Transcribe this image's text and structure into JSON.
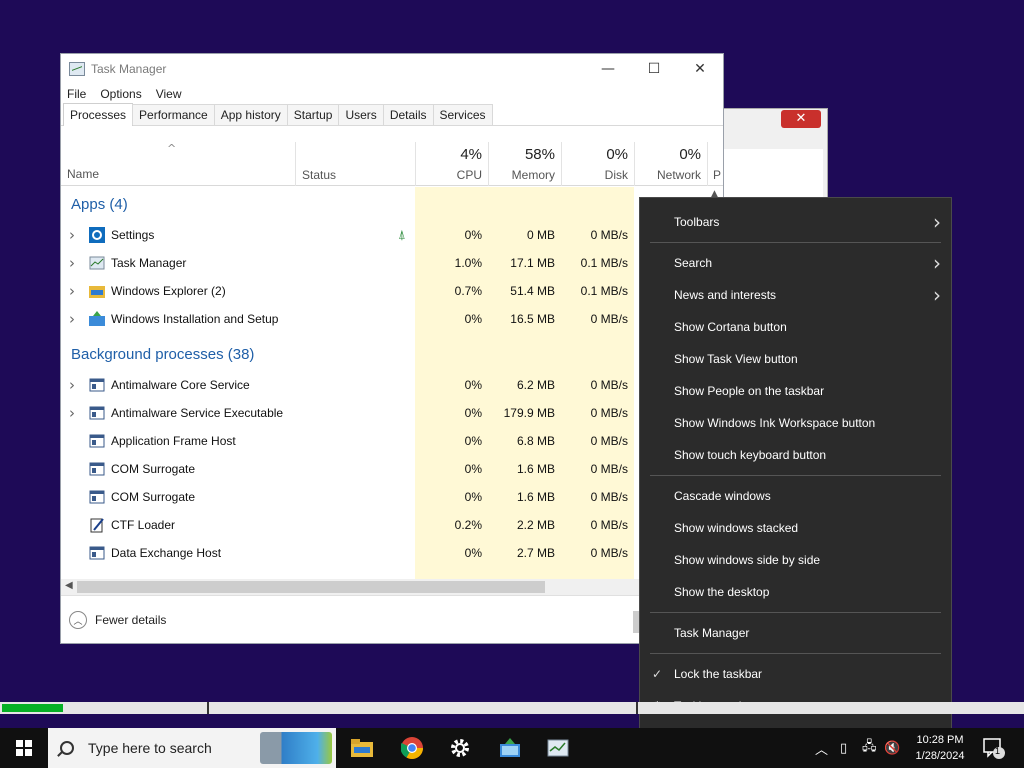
{
  "task_manager": {
    "title": "Task Manager",
    "menu": [
      "File",
      "Options",
      "View"
    ],
    "tabs": [
      "Processes",
      "Performance",
      "App history",
      "Startup",
      "Users",
      "Details",
      "Services"
    ],
    "active_tab": "Processes",
    "columns": {
      "name": "Name",
      "status": "Status",
      "cpu": {
        "pct": "4%",
        "label": "CPU"
      },
      "memory": {
        "pct": "58%",
        "label": "Memory"
      },
      "disk": {
        "pct": "0%",
        "label": "Disk"
      },
      "network": {
        "pct": "0%",
        "label": "Network"
      },
      "power": "P"
    },
    "groups": {
      "apps": "Apps (4)",
      "background": "Background processes (38)"
    },
    "apps": [
      {
        "name": "Settings",
        "cpu": "0%",
        "memory": "0 MB",
        "disk": "0 MB/s",
        "icon": "settings-gear-icon",
        "expandable": true,
        "suspended_leaf": true
      },
      {
        "name": "Task Manager",
        "cpu": "1.0%",
        "memory": "17.1 MB",
        "disk": "0.1 MB/s",
        "icon": "task-manager-icon",
        "expandable": true
      },
      {
        "name": "Windows Explorer (2)",
        "cpu": "0.7%",
        "memory": "51.4 MB",
        "disk": "0.1 MB/s",
        "icon": "folder-icon",
        "expandable": true
      },
      {
        "name": "Windows Installation and Setup",
        "cpu": "0%",
        "memory": "16.5 MB",
        "disk": "0 MB/s",
        "icon": "setup-icon",
        "expandable": true
      }
    ],
    "background": [
      {
        "name": "Antimalware Core Service",
        "cpu": "0%",
        "memory": "6.2 MB",
        "disk": "0 MB/s",
        "expandable": true
      },
      {
        "name": "Antimalware Service Executable",
        "cpu": "0%",
        "memory": "179.9 MB",
        "disk": "0 MB/s",
        "expandable": true
      },
      {
        "name": "Application Frame Host",
        "cpu": "0%",
        "memory": "6.8 MB",
        "disk": "0 MB/s",
        "expandable": false
      },
      {
        "name": "COM Surrogate",
        "cpu": "0%",
        "memory": "1.6 MB",
        "disk": "0 MB/s",
        "expandable": false
      },
      {
        "name": "COM Surrogate",
        "cpu": "0%",
        "memory": "1.6 MB",
        "disk": "0 MB/s",
        "expandable": false
      },
      {
        "name": "CTF Loader",
        "cpu": "0.2%",
        "memory": "2.2 MB",
        "disk": "0 MB/s",
        "expandable": false
      },
      {
        "name": "Data Exchange Host",
        "cpu": "0%",
        "memory": "2.7 MB",
        "disk": "0 MB/s",
        "expandable": false
      }
    ],
    "fewer_details": "Fewer details"
  },
  "context_menu": {
    "items": [
      {
        "label": "Toolbars",
        "submenu": true
      },
      {
        "label": "Search",
        "submenu": true
      },
      {
        "label": "News and interests",
        "submenu": true
      },
      {
        "label": "Show Cortana button"
      },
      {
        "label": "Show Task View button"
      },
      {
        "label": "Show People on the taskbar"
      },
      {
        "label": "Show Windows Ink Workspace button"
      },
      {
        "label": "Show touch keyboard button"
      },
      {
        "label": "Cascade windows"
      },
      {
        "label": "Show windows stacked"
      },
      {
        "label": "Show windows side by side"
      },
      {
        "label": "Show the desktop"
      },
      {
        "label": "Task Manager"
      },
      {
        "label": "Lock the taskbar",
        "checked": true
      },
      {
        "label": "Taskbar settings",
        "icon": "gear-icon"
      }
    ]
  },
  "progress": {
    "fraction": 0.06,
    "color": "#06b025"
  },
  "taskbar": {
    "search_placeholder": "Type here to search",
    "pinned": [
      "file-explorer-icon",
      "chrome-icon",
      "settings-icon",
      "setup-icon",
      "task-manager-icon"
    ],
    "clock": {
      "time": "10:28 PM",
      "date": "1/28/2024"
    },
    "notification_count": "1"
  },
  "colors": {
    "desktop": "#1e0a57",
    "menu_bg": "#2b2b2b",
    "accent_blue": "#1f5fa8",
    "heat_light": "#fff9d6",
    "heat_mid": "#fff1b0"
  }
}
